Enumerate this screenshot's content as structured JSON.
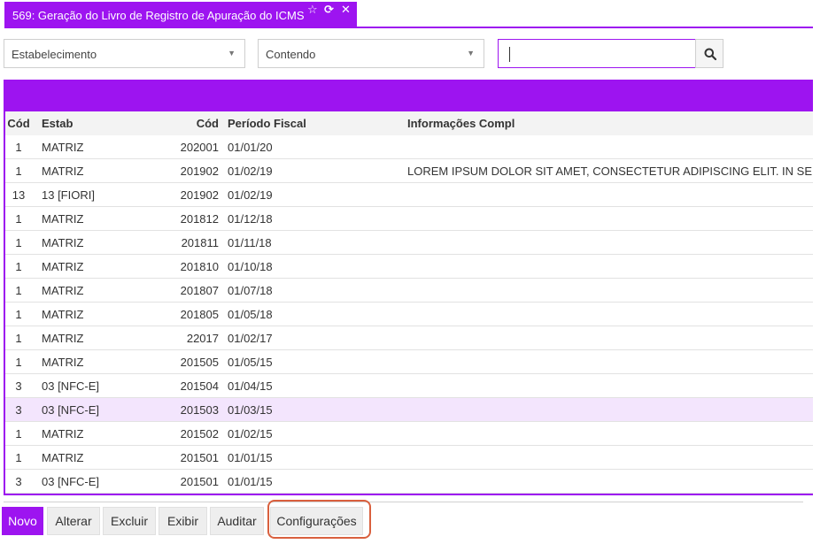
{
  "window": {
    "tab_title": "569: Geração do Livro de Registro de Apuração do ICMS",
    "favorite_icon": "☆",
    "refresh_icon": "⟳",
    "close_icon": "✕"
  },
  "filters": {
    "field_select": "Estabelecimento",
    "operator_select": "Contendo",
    "search_value": ""
  },
  "table": {
    "columns": [
      "Cód",
      "Estab",
      "Cód",
      "Período Fiscal",
      "Informações Compl"
    ],
    "rows": [
      {
        "cod": "1",
        "estab": "MATRIZ",
        "cod2": "202001",
        "periodo": "01/01/20",
        "info": ""
      },
      {
        "cod": "1",
        "estab": "MATRIZ",
        "cod2": "201902",
        "periodo": "01/02/19",
        "info": "LOREM IPSUM DOLOR SIT AMET, CONSECTETUR ADIPISCING ELIT. IN SE"
      },
      {
        "cod": "13",
        "estab": "13 [FIORI]",
        "cod2": "201902",
        "periodo": "01/02/19",
        "info": ""
      },
      {
        "cod": "1",
        "estab": "MATRIZ",
        "cod2": "201812",
        "periodo": "01/12/18",
        "info": ""
      },
      {
        "cod": "1",
        "estab": "MATRIZ",
        "cod2": "201811",
        "periodo": "01/11/18",
        "info": ""
      },
      {
        "cod": "1",
        "estab": "MATRIZ",
        "cod2": "201810",
        "periodo": "01/10/18",
        "info": ""
      },
      {
        "cod": "1",
        "estab": "MATRIZ",
        "cod2": "201807",
        "periodo": "01/07/18",
        "info": ""
      },
      {
        "cod": "1",
        "estab": "MATRIZ",
        "cod2": "201805",
        "periodo": "01/05/18",
        "info": ""
      },
      {
        "cod": "1",
        "estab": "MATRIZ",
        "cod2": "22017",
        "periodo": "01/02/17",
        "info": ""
      },
      {
        "cod": "1",
        "estab": "MATRIZ",
        "cod2": "201505",
        "periodo": "01/05/15",
        "info": ""
      },
      {
        "cod": "3",
        "estab": "03 [NFC-E]",
        "cod2": "201504",
        "periodo": "01/04/15",
        "info": ""
      },
      {
        "cod": "3",
        "estab": "03 [NFC-E]",
        "cod2": "201503",
        "periodo": "01/03/15",
        "info": ""
      },
      {
        "cod": "1",
        "estab": "MATRIZ",
        "cod2": "201502",
        "periodo": "01/02/15",
        "info": ""
      },
      {
        "cod": "1",
        "estab": "MATRIZ",
        "cod2": "201501",
        "periodo": "01/01/15",
        "info": ""
      },
      {
        "cod": "3",
        "estab": "03 [NFC-E]",
        "cod2": "201501",
        "periodo": "01/01/15",
        "info": ""
      }
    ],
    "selected_row": 11
  },
  "toolbar": {
    "novo": "Novo",
    "alterar": "Alterar",
    "excluir": "Excluir",
    "exibir": "Exibir",
    "auditar": "Auditar",
    "configuracoes": "Configurações"
  },
  "colors": {
    "accent": "#9d14f0",
    "selected_row": "#f3e5fd",
    "highlight": "#d9603e"
  }
}
